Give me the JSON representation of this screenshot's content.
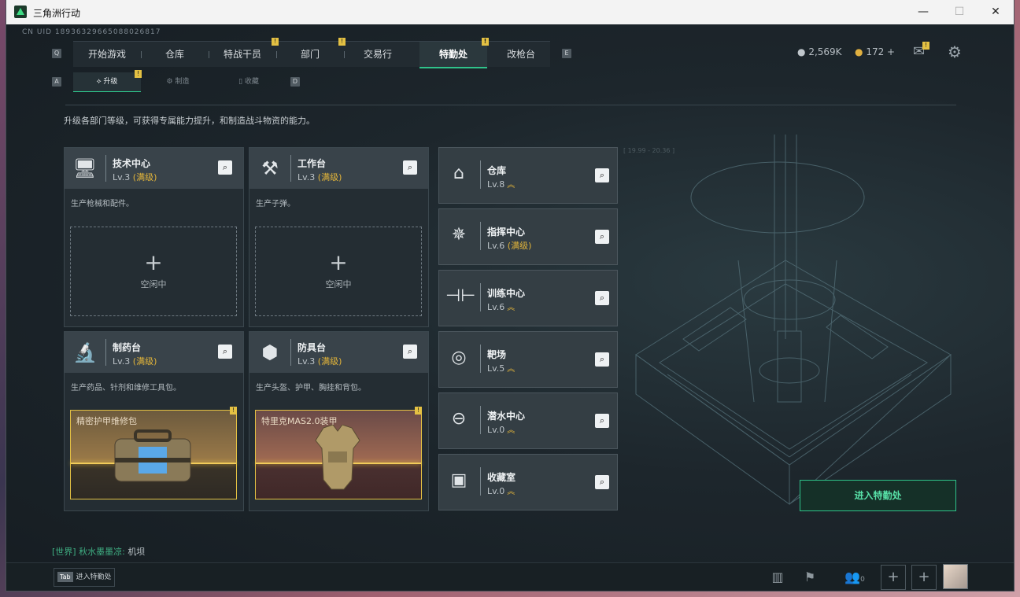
{
  "window": {
    "title": "三角洲行动",
    "minimize": "—",
    "maximize": "☐",
    "close": "✕"
  },
  "uid": "CN UID 18936329665088026817",
  "keys": {
    "left": "Q",
    "right": "E",
    "subleft": "A",
    "subright": "D"
  },
  "main_tabs": [
    {
      "label": "开始游戏"
    },
    {
      "label": "仓库"
    },
    {
      "label": "特战干员",
      "badge": "!"
    },
    {
      "label": "部门",
      "badge": "!"
    },
    {
      "label": "交易行"
    },
    {
      "label": "特勤处",
      "badge": "!"
    },
    {
      "label": "改枪台"
    }
  ],
  "currency": {
    "coins": "2,569K",
    "tokens": "172 +"
  },
  "mail_badge": "!",
  "sub_tabs": [
    {
      "label": "升级",
      "badge": "!"
    },
    {
      "label": "制造"
    },
    {
      "label": "收藏"
    }
  ],
  "description": "升级各部门等级，可获得专属能力提升，和制造战斗物资的能力。",
  "production_cards": [
    {
      "name": "技术中心",
      "level": "Lv.3",
      "max": "(满级)",
      "desc": "生产枪械和配件。",
      "slot": {
        "plus": "+",
        "label": "空闲中"
      }
    },
    {
      "name": "工作台",
      "level": "Lv.3",
      "max": "(满级)",
      "desc": "生产子弹。",
      "slot": {
        "plus": "+",
        "label": "空闲中"
      }
    },
    {
      "name": "制药台",
      "level": "Lv.3",
      "max": "(满级)",
      "desc": "生产药品、针剂和维修工具包。",
      "product": {
        "name": "精密护甲维修包",
        "badge": "!"
      }
    },
    {
      "name": "防具台",
      "level": "Lv.3",
      "max": "(满级)",
      "desc": "生产头盔、护甲、胸挂和背包。",
      "product": {
        "name": "特里克MAS2.0装甲",
        "badge": "!"
      }
    }
  ],
  "facilities": [
    {
      "name": "仓库",
      "level": "Lv.8",
      "upgrade": "︽"
    },
    {
      "name": "指挥中心",
      "level": "Lv.6",
      "max": "(满级)"
    },
    {
      "name": "训练中心",
      "level": "Lv.6",
      "upgrade": "︽"
    },
    {
      "name": "靶场",
      "level": "Lv.5",
      "upgrade": "︽"
    },
    {
      "name": "潜水中心",
      "level": "Lv.0",
      "upgrade": "︽"
    },
    {
      "name": "收藏室",
      "level": "Lv.0",
      "upgrade": "︽"
    }
  ],
  "enter_button": "进入特勤处",
  "chat": {
    "channel": "[世界]",
    "nick": "秋水墨墨凉:",
    "message": "机坝"
  },
  "tab_hint": {
    "key": "Tab",
    "label": "进入特勤处"
  },
  "bottom": {
    "friends": "0"
  },
  "deco_text": "[ 19.99 - 20.36 ]",
  "icons": {
    "search": "⌕",
    "plus": "+"
  }
}
